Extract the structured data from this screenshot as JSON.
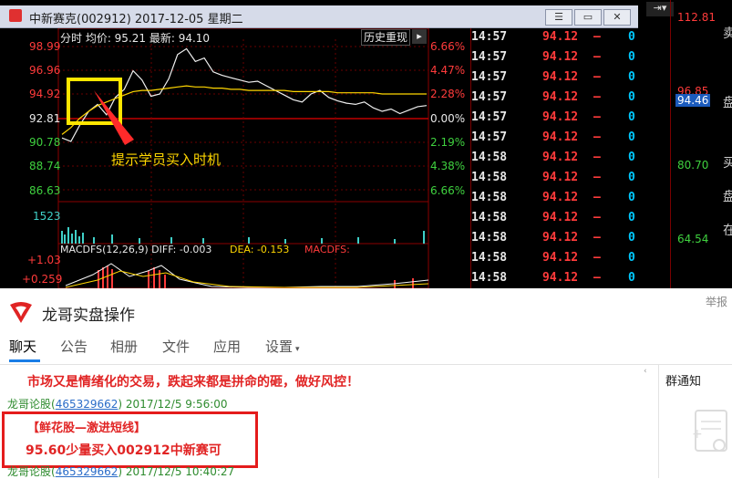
{
  "stock_window": {
    "title": "中新赛克(002912)  2017-12-05 星期二",
    "buttons": {
      "menu": "☰",
      "minimize": "—",
      "maximize": "▭",
      "close": "✕"
    },
    "chart_header": {
      "label": "分时 均价: 95.21 最新: 94.10",
      "history_button": "历史重现"
    },
    "price_ticks": [
      "98.99",
      "96.96",
      "94.92",
      "92.81",
      "90.78",
      "88.74",
      "86.63"
    ],
    "pct_ticks": [
      "6.66%",
      "4.47%",
      "2.28%",
      "0.00%",
      "2.19%",
      "4.38%",
      "6.66%"
    ],
    "volume_tick": "1523",
    "macd_label": "MACDFS(12,26,9)  DIFF: -0.003",
    "macd_dea": "DEA: -0.153",
    "macd_fs": "MACDFS: ",
    "macd_ticks": [
      "+1.03",
      "+0.259"
    ],
    "annotation": "提示学员买入时机",
    "quotes": [
      {
        "time": "14:57",
        "price": "94.12",
        "dash": "–",
        "vol": "0"
      },
      {
        "time": "14:57",
        "price": "94.12",
        "dash": "–",
        "vol": "0"
      },
      {
        "time": "14:57",
        "price": "94.12",
        "dash": "–",
        "vol": "0"
      },
      {
        "time": "14:57",
        "price": "94.12",
        "dash": "–",
        "vol": "0"
      },
      {
        "time": "14:57",
        "price": "94.12",
        "dash": "–",
        "vol": "0"
      },
      {
        "time": "14:57",
        "price": "94.12",
        "dash": "–",
        "vol": "0"
      },
      {
        "time": "14:58",
        "price": "94.12",
        "dash": "–",
        "vol": "0"
      },
      {
        "time": "14:58",
        "price": "94.12",
        "dash": "–",
        "vol": "0"
      },
      {
        "time": "14:58",
        "price": "94.12",
        "dash": "–",
        "vol": "0"
      },
      {
        "time": "14:58",
        "price": "94.12",
        "dash": "–",
        "vol": "0"
      },
      {
        "time": "14:58",
        "price": "94.12",
        "dash": "–",
        "vol": "0"
      },
      {
        "time": "14:58",
        "price": "94.12",
        "dash": "–",
        "vol": "0"
      },
      {
        "time": "14:58",
        "price": "94.12",
        "dash": "–",
        "vol": "0"
      }
    ],
    "right_panel": {
      "prices": [
        "112.81",
        "96.85",
        "94.46",
        "80.70",
        "64.54"
      ],
      "chars": [
        "卖",
        "盘",
        "买",
        "盘",
        "在"
      ]
    }
  },
  "chat": {
    "group_name": "龙哥实盘操作",
    "report": "举报",
    "tabs": [
      "聊天",
      "公告",
      "相册",
      "文件",
      "应用",
      "设置"
    ],
    "notice_title": "群通知",
    "banner": "市场又是情绪化的交易，跌起来都是拼命的砸，做好风控！",
    "messages": [
      {
        "sender": "龙哥论股",
        "id": "465329662",
        "time": "2017/12/5 9:56:00",
        "lines": [
          "【鲜花股—激进短线】",
          "95.60少量买入002912中新赛可"
        ]
      },
      {
        "sender": "龙哥论股",
        "id": "465329662",
        "time": "2017/12/5 10:40:27",
        "lines": []
      }
    ]
  },
  "chart_data": {
    "type": "line",
    "ylim": [
      86.63,
      98.99
    ],
    "series": [
      {
        "values": [
          91.1,
          90.8,
          92.2,
          93.4,
          94.0,
          93.1,
          94.6,
          95.3,
          96.9,
          96.1,
          94.7,
          94.9,
          96.2,
          98.3,
          98.8,
          97.7,
          98.0,
          96.8,
          96.5,
          96.3,
          96.1,
          95.9,
          96.0,
          95.6,
          95.2,
          94.8,
          94.4,
          94.2,
          94.9,
          95.2,
          94.6,
          94.3,
          94.1,
          94.0,
          94.2,
          93.7,
          93.4,
          93.6,
          93.2,
          93.5,
          93.8,
          93.9
        ]
      },
      {
        "values": [
          91.4,
          92.0,
          92.8,
          93.4,
          93.9,
          94.2,
          94.5,
          94.8,
          95.1,
          95.2,
          95.2,
          95.3,
          95.4,
          95.5,
          95.6,
          95.5,
          95.5,
          95.4,
          95.4,
          95.3,
          95.3,
          95.2,
          95.2,
          95.2,
          95.2,
          95.2,
          95.1,
          95.1,
          95.1,
          95.1,
          95.1,
          95.0,
          95.0,
          95.0,
          95.0,
          95.0,
          94.9,
          94.9,
          94.9,
          94.9,
          94.9,
          94.9
        ]
      }
    ]
  }
}
